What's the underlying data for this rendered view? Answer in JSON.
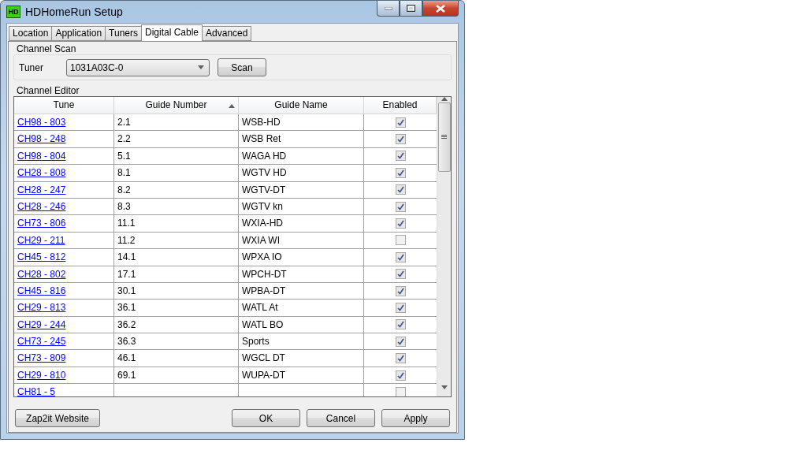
{
  "window": {
    "title": "HDHomeRun Setup",
    "logo": "HD"
  },
  "tabs": [
    {
      "label": "Location",
      "selected": false
    },
    {
      "label": "Application",
      "selected": false
    },
    {
      "label": "Tuners",
      "selected": false
    },
    {
      "label": "Digital Cable",
      "selected": true
    },
    {
      "label": "Advanced",
      "selected": false
    }
  ],
  "channel_scan": {
    "title": "Channel Scan",
    "tuner_label": "Tuner",
    "tuner_value": "1031A03C-0",
    "scan_button": "Scan"
  },
  "channel_editor": {
    "title": "Channel Editor",
    "columns": [
      "Tune",
      "Guide Number",
      "Guide Name",
      "Enabled"
    ],
    "rows": [
      {
        "tune": "CH98 - 803",
        "guide_number": "2.1",
        "guide_name": "WSB-HD",
        "enabled": true
      },
      {
        "tune": "CH98 - 248",
        "guide_number": "2.2",
        "guide_name": "WSB Ret",
        "enabled": true
      },
      {
        "tune": "CH98 - 804",
        "guide_number": "5.1",
        "guide_name": "WAGA HD",
        "enabled": true
      },
      {
        "tune": "CH28 - 808",
        "guide_number": "8.1",
        "guide_name": "WGTV HD",
        "enabled": true
      },
      {
        "tune": "CH28 - 247",
        "guide_number": "8.2",
        "guide_name": "WGTV-DT",
        "enabled": true
      },
      {
        "tune": "CH28 - 246",
        "guide_number": "8.3",
        "guide_name": "WGTV kn",
        "enabled": true
      },
      {
        "tune": "CH73 - 806",
        "guide_number": "11.1",
        "guide_name": "WXIA-HD",
        "enabled": true
      },
      {
        "tune": "CH29 - 211",
        "guide_number": "11.2",
        "guide_name": "WXIA WI",
        "enabled": false
      },
      {
        "tune": "CH45 - 812",
        "guide_number": "14.1",
        "guide_name": "WPXA IO",
        "enabled": true
      },
      {
        "tune": "CH28 - 802",
        "guide_number": "17.1",
        "guide_name": "WPCH-DT",
        "enabled": true
      },
      {
        "tune": "CH45 - 816",
        "guide_number": "30.1",
        "guide_name": "WPBA-DT",
        "enabled": true
      },
      {
        "tune": "CH29 - 813",
        "guide_number": "36.1",
        "guide_name": "WATL At",
        "enabled": true
      },
      {
        "tune": "CH29 - 244",
        "guide_number": "36.2",
        "guide_name": "WATL BO",
        "enabled": true
      },
      {
        "tune": "CH73 - 245",
        "guide_number": "36.3",
        "guide_name": "Sports",
        "enabled": true
      },
      {
        "tune": "CH73 - 809",
        "guide_number": "46.1",
        "guide_name": "WGCL DT",
        "enabled": true
      },
      {
        "tune": "CH29 - 810",
        "guide_number": "69.1",
        "guide_name": "WUPA-DT",
        "enabled": true
      },
      {
        "tune": "CH81 - 5",
        "enabled": false
      }
    ]
  },
  "buttons": {
    "left": "Zap2it Website",
    "right": [
      "OK",
      "Cancel",
      "Apply"
    ]
  }
}
